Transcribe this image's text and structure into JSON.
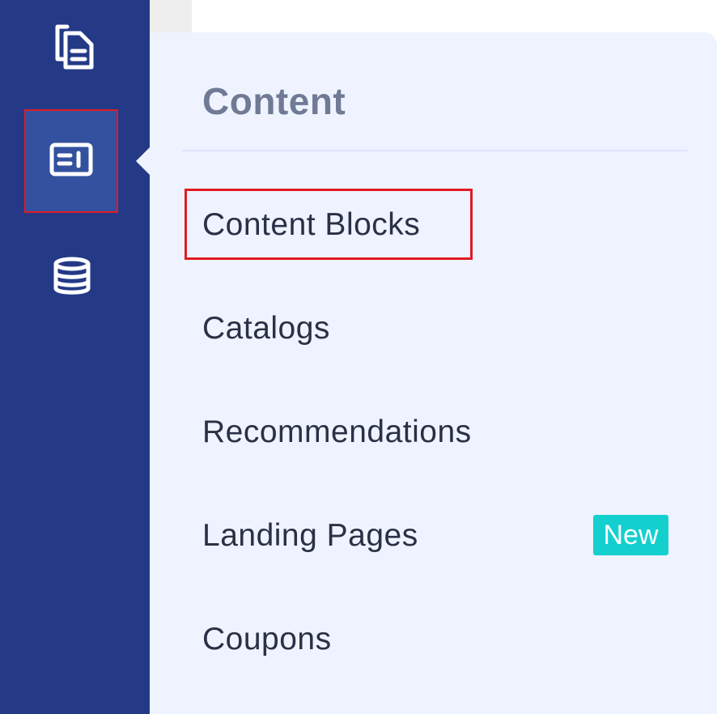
{
  "flyout": {
    "title": "Content",
    "items": [
      {
        "label": "Content Blocks"
      },
      {
        "label": "Catalogs"
      },
      {
        "label": "Recommendations"
      },
      {
        "label": "Landing Pages",
        "badge": "New"
      },
      {
        "label": "Coupons"
      }
    ]
  },
  "sidebar": {
    "icons": [
      "documents-icon",
      "content-blocks-icon",
      "database-icon"
    ],
    "active": "content-blocks-icon"
  },
  "colors": {
    "sidebar_bg": "#243a86",
    "active_bg": "#34519f",
    "flyout_bg": "#eff3ff",
    "badge_bg": "#13d0cf",
    "highlight": "#e11b23"
  }
}
